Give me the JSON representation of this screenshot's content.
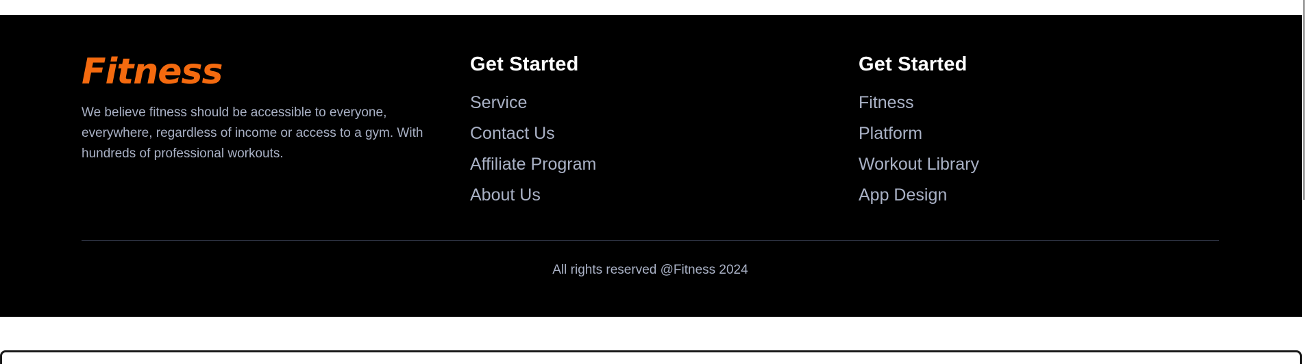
{
  "brand": {
    "name": "Fitness",
    "description": "We believe fitness should be accessible to everyone, everywhere, regardless of income or access to a gym. With hundreds of professional workouts."
  },
  "columns": [
    {
      "heading": "Get Started",
      "links": [
        "Service",
        "Contact Us",
        "Affiliate Program",
        "About Us"
      ]
    },
    {
      "heading": "Get Started",
      "links": [
        "Fitness",
        "Platform",
        "Workout Library",
        "App Design"
      ]
    }
  ],
  "copyright": "All rights reserved @Fitness 2024",
  "colors": {
    "background": "#000000",
    "accent": "#f46a0f",
    "heading": "#ffffff",
    "text": "#a9b1c5",
    "divider": "#2c3140"
  }
}
